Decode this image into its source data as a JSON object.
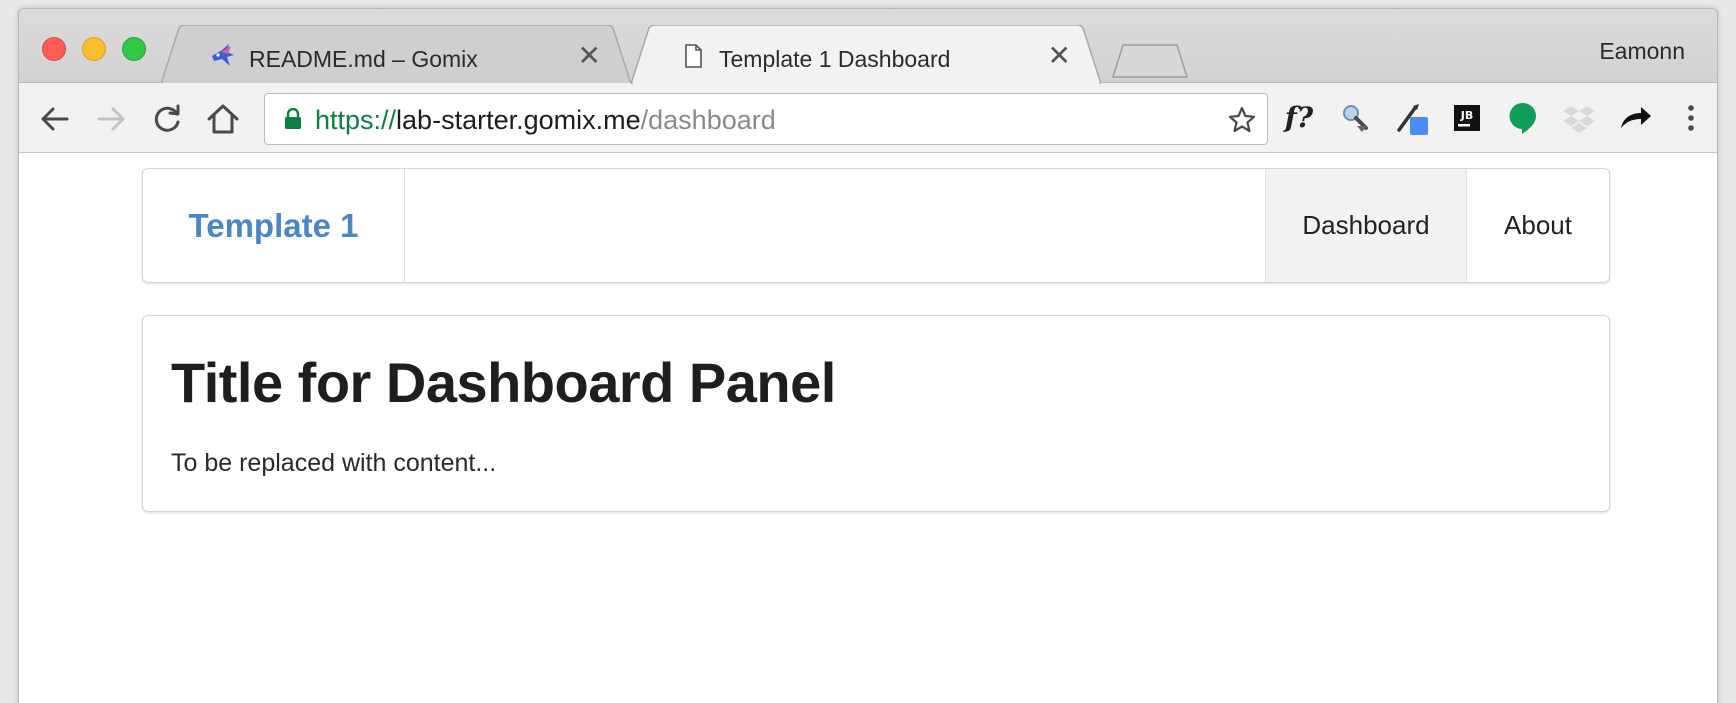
{
  "browser": {
    "profile_name": "Eamonn",
    "tabs": [
      {
        "title": "README.md – Gomix",
        "favicon": "gomix-fish-icon",
        "close": "✕",
        "active": false
      },
      {
        "title": "Template 1 Dashboard",
        "favicon": "document-icon",
        "close": "✕",
        "active": true
      }
    ],
    "toolbar": {
      "back_icon": "arrow-left-icon",
      "forward_icon": "arrow-right-icon",
      "reload_icon": "reload-icon",
      "home_icon": "home-icon",
      "extensions": [
        "function-fx-icon",
        "search-extension-icon",
        "color-picker-icon",
        "jetbrains-icon",
        "hangouts-icon",
        "dropbox-icon",
        "share-arrow-icon",
        "menu-dots-icon"
      ],
      "fx_label": "f?"
    },
    "address": {
      "scheme": "https://",
      "host": "lab-starter.gomix.me",
      "path": "/dashboard",
      "secure": true
    }
  },
  "page": {
    "nav": {
      "brand": "Template 1",
      "items": [
        {
          "label": "Dashboard",
          "active": true
        },
        {
          "label": "About",
          "active": false
        }
      ]
    },
    "panel": {
      "title": "Title for Dashboard Panel",
      "body": "To be replaced with content..."
    }
  },
  "colors": {
    "brand": "#4a87c9",
    "secure_green": "#0b8043",
    "active_nav_bg": "#f2f2f2"
  }
}
